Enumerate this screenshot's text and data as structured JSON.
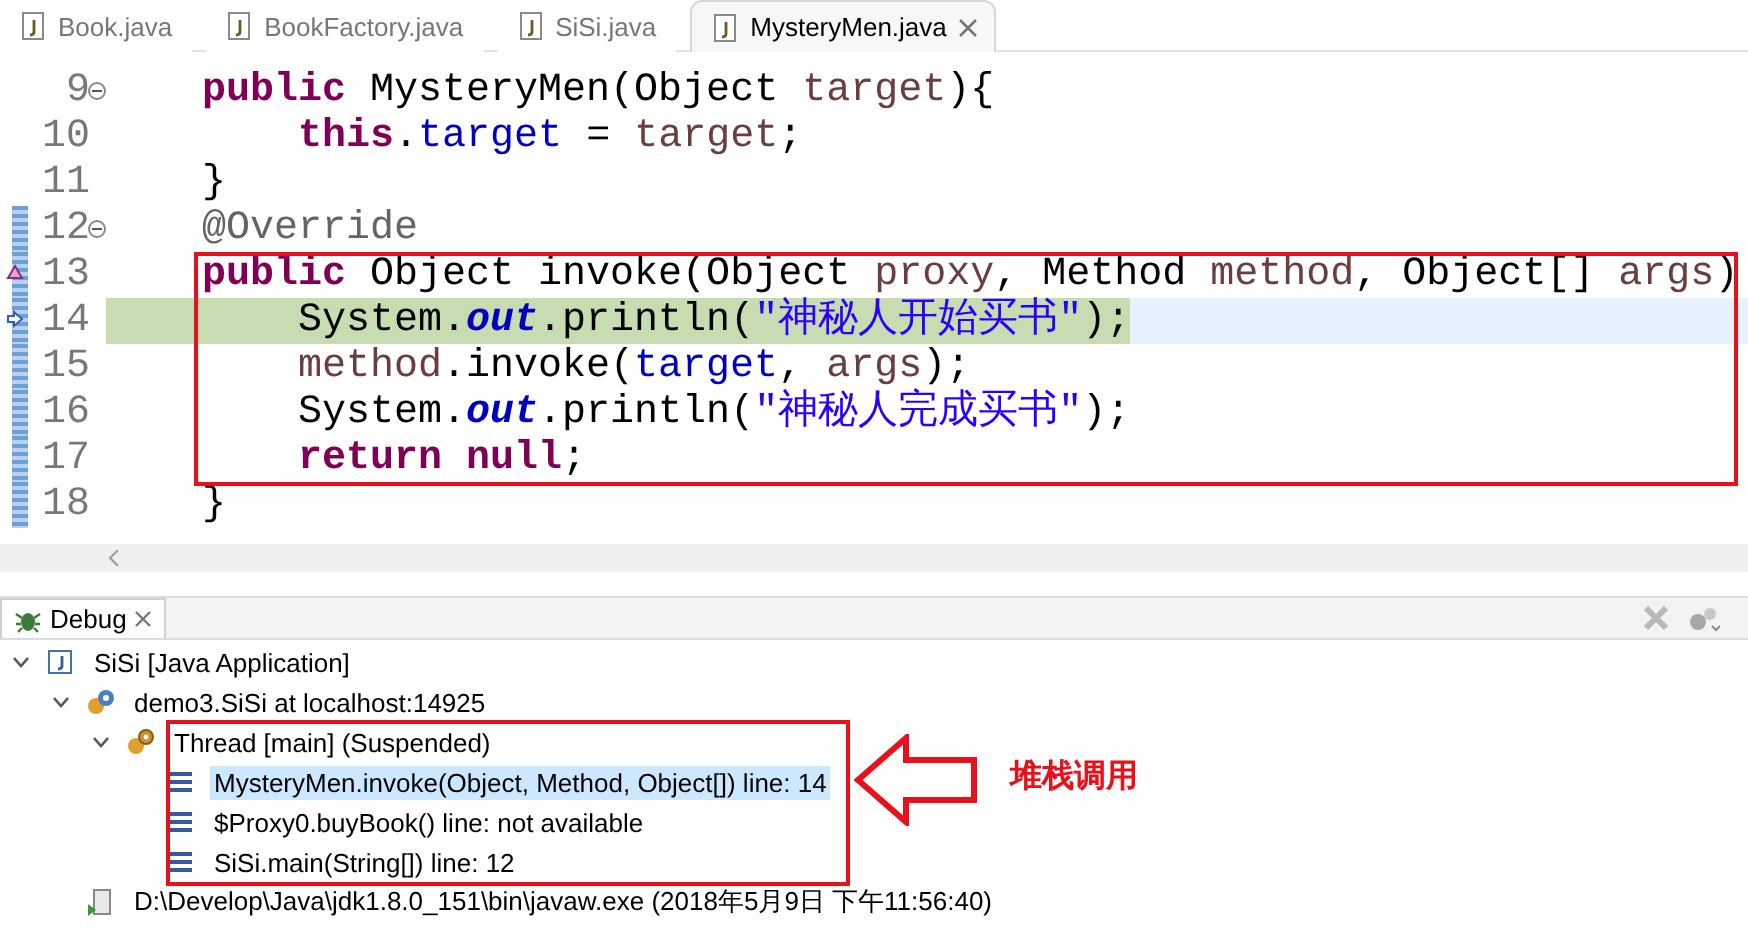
{
  "editor_tabs": [
    {
      "label": "Book.java",
      "selected": false
    },
    {
      "label": "BookFactory.java",
      "selected": false
    },
    {
      "label": "SiSi.java",
      "selected": false
    },
    {
      "label": "MysteryMen.java",
      "selected": true
    }
  ],
  "code_lines": [
    {
      "number": "9",
      "foldable": true,
      "current": false,
      "tokens": [
        {
          "kind": "keyword",
          "text": "    public"
        },
        {
          "kind": "plain",
          "text": " MysteryMen(Object "
        },
        {
          "kind": "param",
          "text": "target"
        },
        {
          "kind": "plain",
          "text": "){"
        }
      ]
    },
    {
      "number": "10",
      "current": false,
      "tokens": [
        {
          "kind": "keyword",
          "text": "        this"
        },
        {
          "kind": "plain",
          "text": "."
        },
        {
          "kind": "field",
          "text": "target"
        },
        {
          "kind": "plain",
          "text": " = "
        },
        {
          "kind": "param",
          "text": "target"
        },
        {
          "kind": "plain",
          "text": ";"
        }
      ]
    },
    {
      "number": "11",
      "current": false,
      "tokens": [
        {
          "kind": "plain",
          "text": "    }"
        }
      ]
    },
    {
      "number": "12",
      "foldable": true,
      "range": true,
      "current": false,
      "tokens": [
        {
          "kind": "annotation",
          "text": "    @Override"
        }
      ]
    },
    {
      "number": "13",
      "overrides": true,
      "range": true,
      "current": false,
      "tokens": [
        {
          "kind": "keyword",
          "text": "    public"
        },
        {
          "kind": "plain",
          "text": " Object invoke(Object "
        },
        {
          "kind": "param",
          "text": "proxy"
        },
        {
          "kind": "plain",
          "text": ", Method "
        },
        {
          "kind": "param",
          "text": "method"
        },
        {
          "kind": "plain",
          "text": ", Object[] "
        },
        {
          "kind": "param",
          "text": "args"
        },
        {
          "kind": "plain",
          "text": ")"
        }
      ]
    },
    {
      "number": "14",
      "range": true,
      "current": true,
      "tokens": [
        {
          "kind": "plain",
          "text": "        System."
        },
        {
          "kind": "static",
          "text": "out"
        },
        {
          "kind": "plain",
          "text": ".println("
        },
        {
          "kind": "string",
          "text": "\"神秘人开始买书\""
        },
        {
          "kind": "plain",
          "text": ");"
        }
      ]
    },
    {
      "number": "15",
      "range": true,
      "current": false,
      "tokens": [
        {
          "kind": "param",
          "text": "        method"
        },
        {
          "kind": "plain",
          "text": ".invoke("
        },
        {
          "kind": "field",
          "text": "target"
        },
        {
          "kind": "plain",
          "text": ", "
        },
        {
          "kind": "param",
          "text": "args"
        },
        {
          "kind": "plain",
          "text": ");"
        }
      ]
    },
    {
      "number": "16",
      "range": true,
      "current": false,
      "tokens": [
        {
          "kind": "plain",
          "text": "        System."
        },
        {
          "kind": "static",
          "text": "out"
        },
        {
          "kind": "plain",
          "text": ".println("
        },
        {
          "kind": "string",
          "text": "\"神秘人完成买书\""
        },
        {
          "kind": "plain",
          "text": ");"
        }
      ]
    },
    {
      "number": "17",
      "range": true,
      "current": false,
      "tokens": [
        {
          "kind": "keyword",
          "text": "        return null"
        },
        {
          "kind": "plain",
          "text": ";"
        }
      ]
    },
    {
      "number": "18",
      "range": true,
      "current": false,
      "tokens": [
        {
          "kind": "plain",
          "text": "    }"
        }
      ]
    }
  ],
  "debug_view": {
    "title": "Debug",
    "tree": [
      {
        "label": "SiSi [Java Application]",
        "kind": "app",
        "expanded": true,
        "selected": false,
        "children": [
          {
            "label": "demo3.SiSi at localhost:14925",
            "kind": "target",
            "expanded": true,
            "selected": false,
            "children": [
              {
                "label": "Thread [main] (Suspended)",
                "kind": "thread",
                "expanded": true,
                "selected": false,
                "children": [
                  {
                    "label": "MysteryMen.invoke(Object, Method, Object[]) line: 14",
                    "kind": "frame",
                    "selected": true
                  },
                  {
                    "label": "$Proxy0.buyBook() line: not available",
                    "kind": "frame",
                    "selected": false
                  },
                  {
                    "label": "SiSi.main(String[]) line: 12",
                    "kind": "frame",
                    "selected": false
                  }
                ]
              }
            ]
          },
          {
            "label": "D:\\Develop\\Java\\jdk1.8.0_151\\bin\\javaw.exe (2018年5月9日 下午11:56:40)",
            "kind": "process",
            "selected": false
          }
        ]
      }
    ]
  },
  "annotation": {
    "label": "堆栈调用"
  }
}
